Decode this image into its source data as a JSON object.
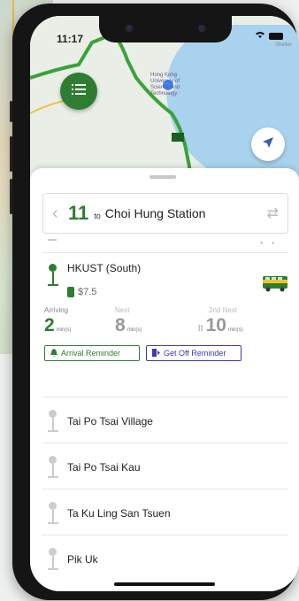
{
  "status_bar": {
    "time": "11:17",
    "battery_label": "battery"
  },
  "map": {
    "place_text": "Hong Kong University of Science and Technology",
    "corner_text": "Shelter"
  },
  "route": {
    "number": "11",
    "to_label": "to",
    "destination": "Choi Hung Station"
  },
  "current_stop": {
    "name": "HKUST (South)",
    "fare": "$7.5",
    "eta": [
      {
        "label": "Arriving",
        "value": "2",
        "unit": "min(s)"
      },
      {
        "label": "Next",
        "value": "8",
        "unit": "min(s)"
      },
      {
        "label": "2nd Next",
        "value": "10",
        "unit": "min(s)"
      }
    ],
    "arrival_reminder": "Arrival Reminder",
    "get_off_reminder": "Get Off Reminder"
  },
  "stops": [
    {
      "name": "Tai Po Tsai Village"
    },
    {
      "name": "Tai Po Tsai Kau"
    },
    {
      "name": "Ta Ku Ling San Tsuen"
    },
    {
      "name": "Pik Uk"
    }
  ],
  "colors": {
    "brand": "#2e7d32",
    "accent_blue": "#3b3bb0",
    "map_route": "#3aa23a"
  },
  "icons": {
    "menu": "list-icon",
    "locate": "navigation-arrow-icon",
    "bus": "bus-icon",
    "bell": "bell-icon",
    "exit": "exit-door-icon",
    "swap": "swap-arrows-icon"
  }
}
